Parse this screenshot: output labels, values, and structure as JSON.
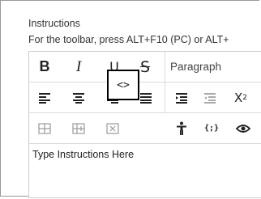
{
  "field": {
    "label": "Instructions",
    "toolbar_hint": "For the toolbar, press ALT+F10 (PC) or ALT+"
  },
  "toolbar": {
    "row1": {
      "bold": "B",
      "italic": "I",
      "underline": "U",
      "strikethrough": "S",
      "paragraph_format": "Paragraph"
    },
    "row2": {
      "superscript_base": "X",
      "superscript_exp": "2"
    },
    "row3": {
      "html_code": "<>",
      "math_symbol": "{;}"
    }
  },
  "editor": {
    "placeholder": "Type Instructions Here"
  },
  "colors": {
    "highlight_border": "#000000",
    "icon_color": "#222222",
    "disabled_icon": "#9a9a9a"
  }
}
